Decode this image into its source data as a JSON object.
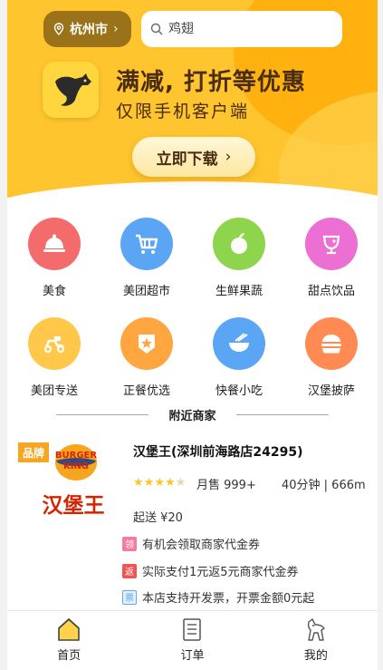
{
  "header": {
    "city": "杭州市",
    "search_placeholder": "鸡翅"
  },
  "banner": {
    "headline": "满减, 打折等优惠",
    "subline": "仅限手机客户端",
    "download_label": "立即下载"
  },
  "categories": [
    {
      "label": "美食",
      "icon": "food-dome-icon",
      "color": "#f46b6b"
    },
    {
      "label": "美团超市",
      "icon": "shopping-cart-icon",
      "color": "#5aa6f5"
    },
    {
      "label": "生鲜果蔬",
      "icon": "apple-icon",
      "color": "#8fd44d"
    },
    {
      "label": "甜点饮品",
      "icon": "drink-cup-icon",
      "color": "#ec6fd4"
    },
    {
      "label": "美团专送",
      "icon": "scooter-icon",
      "color": "#ffc84a"
    },
    {
      "label": "正餐优选",
      "icon": "star-badge-icon",
      "color": "#ffa640"
    },
    {
      "label": "快餐小吃",
      "icon": "noodle-bowl-icon",
      "color": "#5aa6f5"
    },
    {
      "label": "汉堡披萨",
      "icon": "burger-icon",
      "color": "#ff8a52"
    }
  ],
  "nearby": {
    "title": "附近商家"
  },
  "merchant": {
    "tag": "品牌",
    "logo_text": "BURGER KING",
    "logo_cn": "汉堡王",
    "name": "汉堡王(深圳前海路店24295)",
    "rating": 4.5,
    "sales": "月售 999+",
    "delivery": "40分钟 | 666m",
    "min_order": "起送 ¥20",
    "promos": [
      {
        "badge": "领",
        "color": "#f57b9f",
        "text": "有机会领取商家代金券"
      },
      {
        "badge": "返",
        "color": "#f05454",
        "text": "实际支付1元返5元商家代金券"
      },
      {
        "badge": "票",
        "color": "#5aa6f5",
        "text": "本店支持开发票，开票金额0元起"
      }
    ]
  },
  "tabbar": [
    {
      "label": "首页",
      "icon": "home-icon",
      "active": true
    },
    {
      "label": "订单",
      "icon": "orders-icon",
      "active": false
    },
    {
      "label": "我的",
      "icon": "profile-icon",
      "active": false
    }
  ]
}
